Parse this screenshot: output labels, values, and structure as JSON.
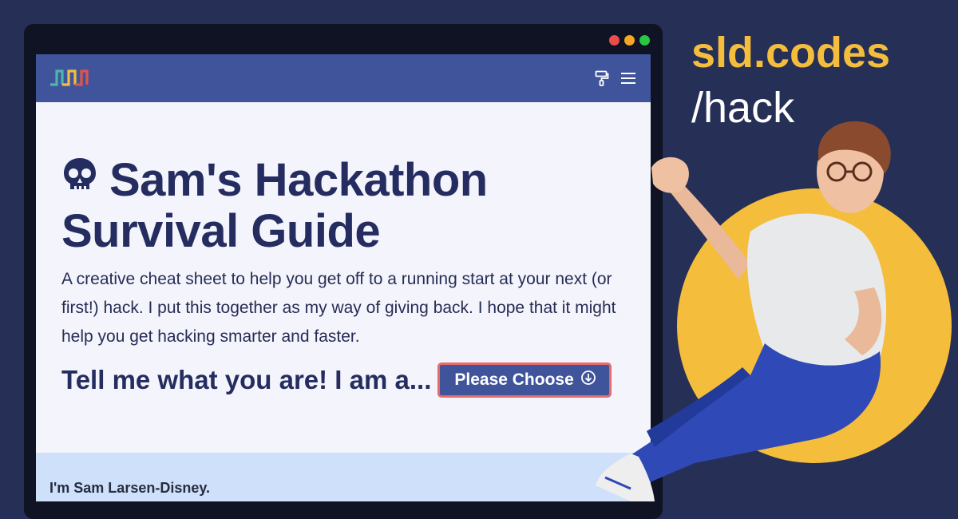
{
  "hero": {
    "title_line1": "Sam's Hackathon",
    "title_line2": "Survival Guide",
    "description": "A creative cheat sheet to help you get off to a running start at your next (or first!) hack. I put this together as my way of giving back. I hope that it might help you get hacking smarter and faster.",
    "cta_text": "Tell me what you are! I am a...",
    "choose_label": "Please Choose"
  },
  "about": {
    "name": "I'm Sam Larsen-Disney."
  },
  "brand": {
    "title": "sld.codes",
    "path": "/hack"
  },
  "icons": {
    "skull": "skull-icon",
    "paint": "paint-roller-icon",
    "menu": "hamburger-menu-icon",
    "arrow": "arrow-down-circle-icon",
    "logo": "site-logo"
  },
  "colors": {
    "background": "#262f56",
    "navbar": "#40549b",
    "accent_yellow": "#f4bd3c",
    "button_border": "#e56a6a",
    "about_band": "#cfe0fb",
    "dot_red": "#ed4c4b",
    "dot_yellow": "#f5a623",
    "dot_green": "#28c840"
  }
}
